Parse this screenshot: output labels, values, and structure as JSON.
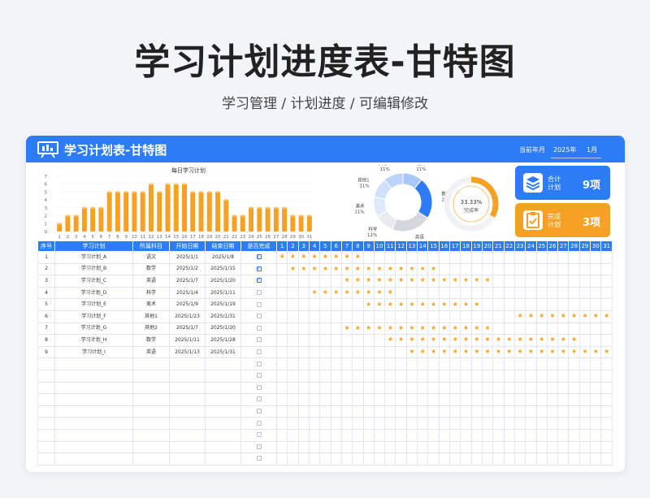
{
  "page": {
    "title": "学习计划进度表-甘特图",
    "subtitle": "学习管理 / 计划进度 / 可编辑修改"
  },
  "header": {
    "title": "学习计划表-甘特图",
    "year_label": "当前年月",
    "year": "2025年",
    "month": "1月"
  },
  "colors": {
    "primary": "#2d7cf6",
    "accent": "#f7a124"
  },
  "kpi": {
    "total_label": "合计 计划",
    "total_value": "9项",
    "total_icon": "layers-icon",
    "done_label": "完成 计划",
    "done_value": "3项",
    "done_icon": "clipboard-check-icon"
  },
  "ring": {
    "value": 0.3333,
    "label": "33.33%",
    "caption": "完成率"
  },
  "chart_data": [
    {
      "type": "bar",
      "title": "每日学习计划",
      "categories": [
        "1",
        "2",
        "3",
        "4",
        "5",
        "6",
        "7",
        "8",
        "9",
        "10",
        "11",
        "12",
        "13",
        "14",
        "15",
        "16",
        "17",
        "18",
        "19",
        "20",
        "21",
        "22",
        "23",
        "24",
        "25",
        "26",
        "27",
        "28",
        "29",
        "30",
        "31"
      ],
      "values": [
        1,
        2,
        2,
        3,
        3,
        3,
        5,
        5,
        5,
        5,
        5,
        6,
        5,
        6,
        6,
        6,
        5,
        5,
        5,
        5,
        4,
        2,
        2,
        3,
        3,
        3,
        3,
        3,
        2,
        2,
        2
      ],
      "ylim": [
        0,
        7
      ],
      "yticks": [
        "0",
        "1",
        "2",
        "3",
        "4",
        "5",
        "6",
        "7"
      ]
    },
    {
      "type": "pie",
      "slices": [
        {
          "name": "语文",
          "value": 11,
          "label": "11%",
          "color": "#a8c8fa"
        },
        {
          "name": "数学",
          "value": 23,
          "label": "23%",
          "color": "#2d7cf6"
        },
        {
          "name": "英语",
          "value": 22,
          "label": "22%",
          "color": "#d4d7dd"
        },
        {
          "name": "科学",
          "value": 11,
          "label": "11%",
          "color": "#e9ebef"
        },
        {
          "name": "美术",
          "value": 11,
          "label": "11%",
          "color": "#dfe9fa"
        },
        {
          "name": "其他1",
          "value": 11,
          "label": "11%",
          "color": "#cfe0fc"
        },
        {
          "name": "其他2",
          "value": 11,
          "label": "11%",
          "color": "#bcd4fb"
        }
      ]
    }
  ],
  "table": {
    "headers": [
      "序号",
      "学习计划",
      "所属科目",
      "开始日期",
      "结束日期",
      "是否完成"
    ],
    "days": [
      "1",
      "2",
      "3",
      "4",
      "5",
      "6",
      "7",
      "8",
      "9",
      "10",
      "11",
      "12",
      "13",
      "14",
      "15",
      "16",
      "17",
      "18",
      "19",
      "20",
      "21",
      "22",
      "23",
      "24",
      "25",
      "26",
      "27",
      "28",
      "29",
      "30",
      "31"
    ],
    "rows": [
      {
        "no": "1",
        "plan": "学习计划_A",
        "subject": "语文",
        "start": "2025/1/1",
        "end": "2025/1/8",
        "done": true,
        "from": 1,
        "to": 8
      },
      {
        "no": "2",
        "plan": "学习计划_B",
        "subject": "数学",
        "start": "2025/1/2",
        "end": "2025/1/15",
        "done": true,
        "from": 2,
        "to": 15
      },
      {
        "no": "3",
        "plan": "学习计划_C",
        "subject": "英语",
        "start": "2025/1/7",
        "end": "2025/1/20",
        "done": true,
        "from": 7,
        "to": 20
      },
      {
        "no": "4",
        "plan": "学习计划_D",
        "subject": "科学",
        "start": "2025/1/4",
        "end": "2025/1/11",
        "done": false,
        "from": 4,
        "to": 11
      },
      {
        "no": "5",
        "plan": "学习计划_E",
        "subject": "美术",
        "start": "2025/1/9",
        "end": "2025/1/19",
        "done": false,
        "from": 9,
        "to": 19
      },
      {
        "no": "6",
        "plan": "学习计划_F",
        "subject": "其他1",
        "start": "2025/1/23",
        "end": "2025/1/31",
        "done": false,
        "from": 23,
        "to": 31
      },
      {
        "no": "7",
        "plan": "学习计划_G",
        "subject": "其他2",
        "start": "2025/1/7",
        "end": "2025/1/20",
        "done": false,
        "from": 7,
        "to": 20
      },
      {
        "no": "8",
        "plan": "学习计划_H",
        "subject": "数学",
        "start": "2025/1/11",
        "end": "2025/1/28",
        "done": false,
        "from": 11,
        "to": 28
      },
      {
        "no": "9",
        "plan": "学习计划_I",
        "subject": "英语",
        "start": "2025/1/13",
        "end": "2025/1/31",
        "done": false,
        "from": 13,
        "to": 31
      }
    ],
    "empty_rows": 9
  }
}
